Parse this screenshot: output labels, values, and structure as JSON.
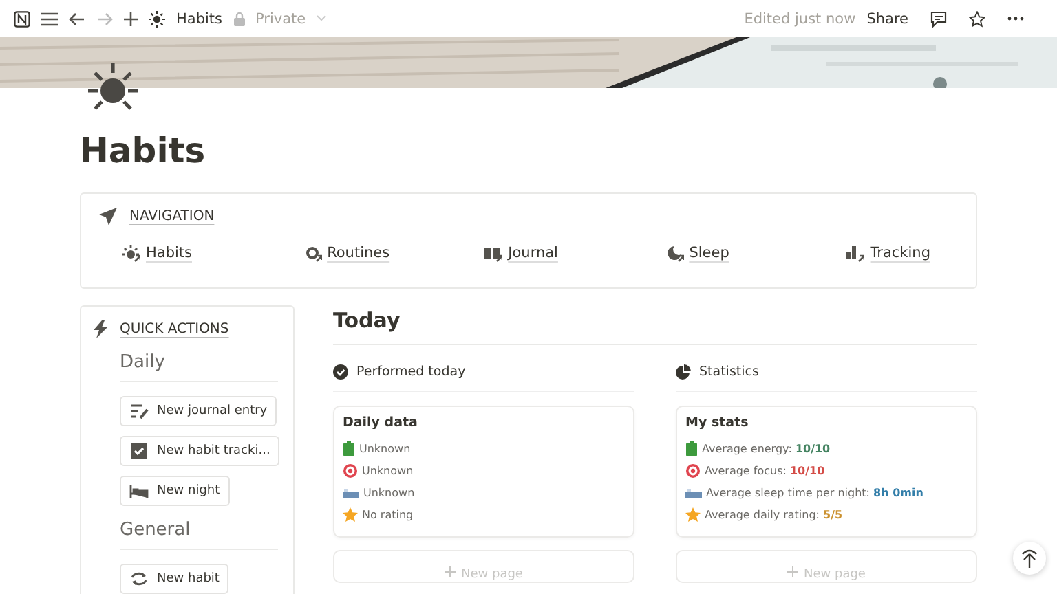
{
  "topbar": {
    "breadcrumb": "Habits",
    "privacy": "Private",
    "edited": "Edited just now",
    "share": "Share"
  },
  "page": {
    "title": "Habits"
  },
  "navigation": {
    "title": "NAVIGATION",
    "links": [
      {
        "label": "Habits",
        "kind": "sun"
      },
      {
        "label": "Routines",
        "kind": "gear"
      },
      {
        "label": "Journal",
        "kind": "book"
      },
      {
        "label": "Sleep",
        "kind": "moon"
      },
      {
        "label": "Tracking",
        "kind": "chart"
      }
    ]
  },
  "quick_actions": {
    "title": "QUICK ACTIONS",
    "groups": [
      {
        "heading": "Daily",
        "buttons": [
          {
            "label": "New journal entry",
            "kind": "pen"
          },
          {
            "label": "New habit tracki...",
            "kind": "check"
          },
          {
            "label": "New night",
            "kind": "bed"
          }
        ]
      },
      {
        "heading": "General",
        "buttons": [
          {
            "label": "New habit",
            "kind": "repeat"
          }
        ]
      }
    ]
  },
  "today": {
    "heading": "Today",
    "columns": [
      {
        "title": "Performed today",
        "kind": "check",
        "card_title": "Daily data",
        "rows": [
          {
            "kind": "battery",
            "label": "Unknown"
          },
          {
            "kind": "target",
            "label": "Unknown"
          },
          {
            "kind": "bed",
            "label": "Unknown"
          },
          {
            "kind": "star",
            "label": "No rating"
          }
        ],
        "new_page": "New page"
      },
      {
        "title": "Statistics",
        "kind": "pie",
        "card_title": "My stats",
        "rows": [
          {
            "kind": "battery",
            "label": "Average energy: ",
            "value": "10/10",
            "color": "#448361"
          },
          {
            "kind": "target",
            "label": "Average focus: ",
            "value": "10/10",
            "color": "#d44c47"
          },
          {
            "kind": "bed",
            "label": "Average sleep time per night: ",
            "value": "8h 0min",
            "color": "#337ea9"
          },
          {
            "kind": "star",
            "label": "Average daily rating: ",
            "value": "5/5",
            "color": "#cb912f"
          }
        ],
        "new_page": "New page"
      }
    ]
  }
}
